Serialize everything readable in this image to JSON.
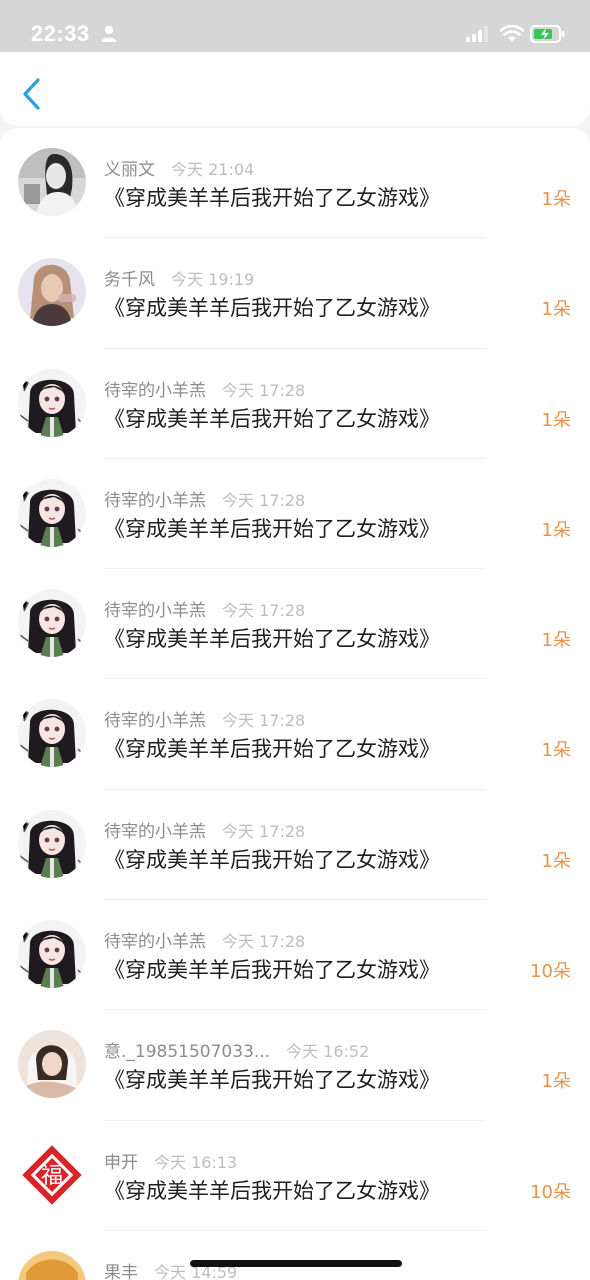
{
  "status_bar": {
    "time": "22:33"
  },
  "list": [
    {
      "name": "义丽文",
      "time": "今天 21:04",
      "title": "《穿成美羊羊后我开始了乙女游戏》",
      "count": "1朵",
      "avatar": "avatar-photo-girl-bw"
    },
    {
      "name": "务千风",
      "time": "今天 19:19",
      "title": "《穿成美羊羊后我开始了乙女游戏》",
      "count": "1朵",
      "avatar": "avatar-photo-girl-long-hair"
    },
    {
      "name": "待宰的小羊羔",
      "time": "今天 17:28",
      "title": "《穿成美羊羊后我开始了乙女游戏》",
      "count": "1朵",
      "avatar": "avatar-anime-girl"
    },
    {
      "name": "待宰的小羊羔",
      "time": "今天 17:28",
      "title": "《穿成美羊羊后我开始了乙女游戏》",
      "count": "1朵",
      "avatar": "avatar-anime-girl"
    },
    {
      "name": "待宰的小羊羔",
      "time": "今天 17:28",
      "title": "《穿成美羊羊后我开始了乙女游戏》",
      "count": "1朵",
      "avatar": "avatar-anime-girl"
    },
    {
      "name": "待宰的小羊羔",
      "time": "今天 17:28",
      "title": "《穿成美羊羊后我开始了乙女游戏》",
      "count": "1朵",
      "avatar": "avatar-anime-girl"
    },
    {
      "name": "待宰的小羊羔",
      "time": "今天 17:28",
      "title": "《穿成美羊羊后我开始了乙女游戏》",
      "count": "1朵",
      "avatar": "avatar-anime-girl"
    },
    {
      "name": "待宰的小羊羔",
      "time": "今天 17:28",
      "title": "《穿成美羊羊后我开始了乙女游戏》",
      "count": "10朵",
      "avatar": "avatar-anime-girl"
    },
    {
      "name": "意._19851507033...",
      "time": "今天 16:52",
      "title": "《穿成美羊羊后我开始了乙女游戏》",
      "count": "1朵",
      "avatar": "avatar-photo-girl-hood"
    },
    {
      "name": "申开",
      "time": "今天 16:13",
      "title": "《穿成美羊羊后我开始了乙女游戏》",
      "count": "10朵",
      "avatar": "avatar-fu-paper-cut"
    },
    {
      "name": "果丰",
      "time": "今天 14:59",
      "title": "",
      "count": "",
      "avatar": "avatar-cartoon"
    }
  ],
  "colors": {
    "accent": "#2a9fe0",
    "count": "#e8914a",
    "status_bar": "#d6d6d6"
  },
  "icons": [
    "person-icon",
    "signal-icon",
    "wifi-icon",
    "battery-icon",
    "back-arrow-icon"
  ]
}
